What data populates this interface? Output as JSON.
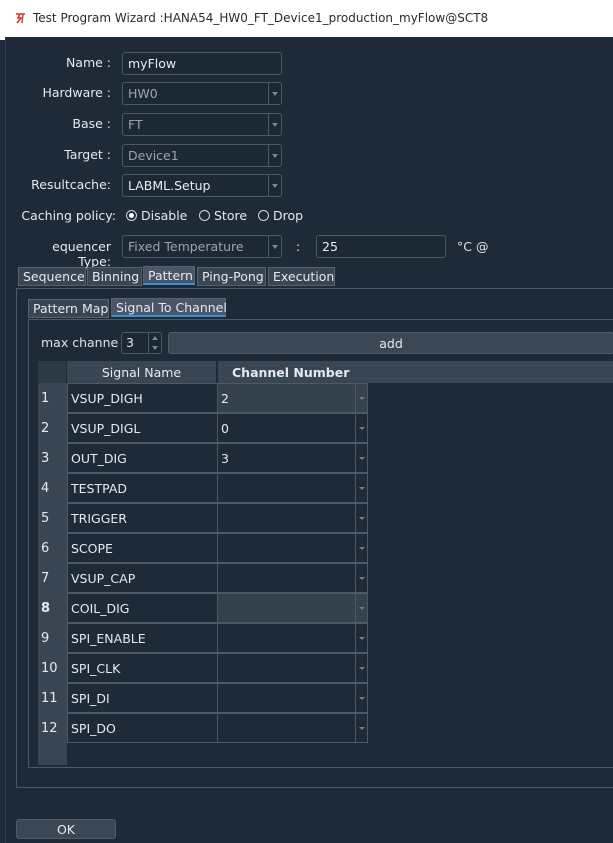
{
  "window": {
    "title": "Test Program Wizard :HANA54_HW0_FT_Device1_production_myFlow@SCT8"
  },
  "form": {
    "name": {
      "label": "Name :",
      "value": "myFlow"
    },
    "hardware": {
      "label": "Hardware :",
      "value": "HW0"
    },
    "base": {
      "label": "Base :",
      "value": "FT"
    },
    "target": {
      "label": "Target :",
      "value": "Device1"
    },
    "resultcache": {
      "label": "Resultcache:",
      "value": "LABML.Setup"
    },
    "caching": {
      "label": "Caching policy:",
      "options": [
        "Disable",
        "Store",
        "Drop"
      ],
      "selected": "Disable"
    },
    "sequencer": {
      "label": "equencer Type:",
      "value": "Fixed Temperature",
      "colon": ":",
      "temperature": "25",
      "unit": "°C @"
    }
  },
  "tabs": [
    "Sequence",
    "Binning",
    "Pattern",
    "Ping-Pong",
    "Execution"
  ],
  "active_tab": "Pattern",
  "subtabs": [
    "Pattern Map",
    "Signal To Channel"
  ],
  "active_subtab": "Signal To Channel",
  "channel_panel": {
    "max_label": "max channe",
    "max_value": "3",
    "add_label": "add"
  },
  "table": {
    "headers": [
      "Signal Name",
      "Channel Number"
    ],
    "rows": [
      {
        "num": "1",
        "signal": "VSUP_DIGH",
        "channel": "2"
      },
      {
        "num": "2",
        "signal": "VSUP_DIGL",
        "channel": "0"
      },
      {
        "num": "3",
        "signal": "OUT_DIG",
        "channel": "3"
      },
      {
        "num": "4",
        "signal": "TESTPAD",
        "channel": ""
      },
      {
        "num": "5",
        "signal": "TRIGGER",
        "channel": ""
      },
      {
        "num": "6",
        "signal": "SCOPE",
        "channel": ""
      },
      {
        "num": "7",
        "signal": "VSUP_CAP",
        "channel": ""
      },
      {
        "num": "8",
        "signal": "COIL_DIG",
        "channel": ""
      },
      {
        "num": "9",
        "signal": "SPI_ENABLE",
        "channel": ""
      },
      {
        "num": "10",
        "signal": "SPI_CLK",
        "channel": ""
      },
      {
        "num": "11",
        "signal": "SPI_DI",
        "channel": ""
      },
      {
        "num": "12",
        "signal": "SPI_DO",
        "channel": ""
      }
    ]
  },
  "footer": {
    "ok_label": "OK"
  },
  "colors": {
    "background": "#1e2a38",
    "accent": "#3d8fd6",
    "app_icon": "#d9342b"
  }
}
